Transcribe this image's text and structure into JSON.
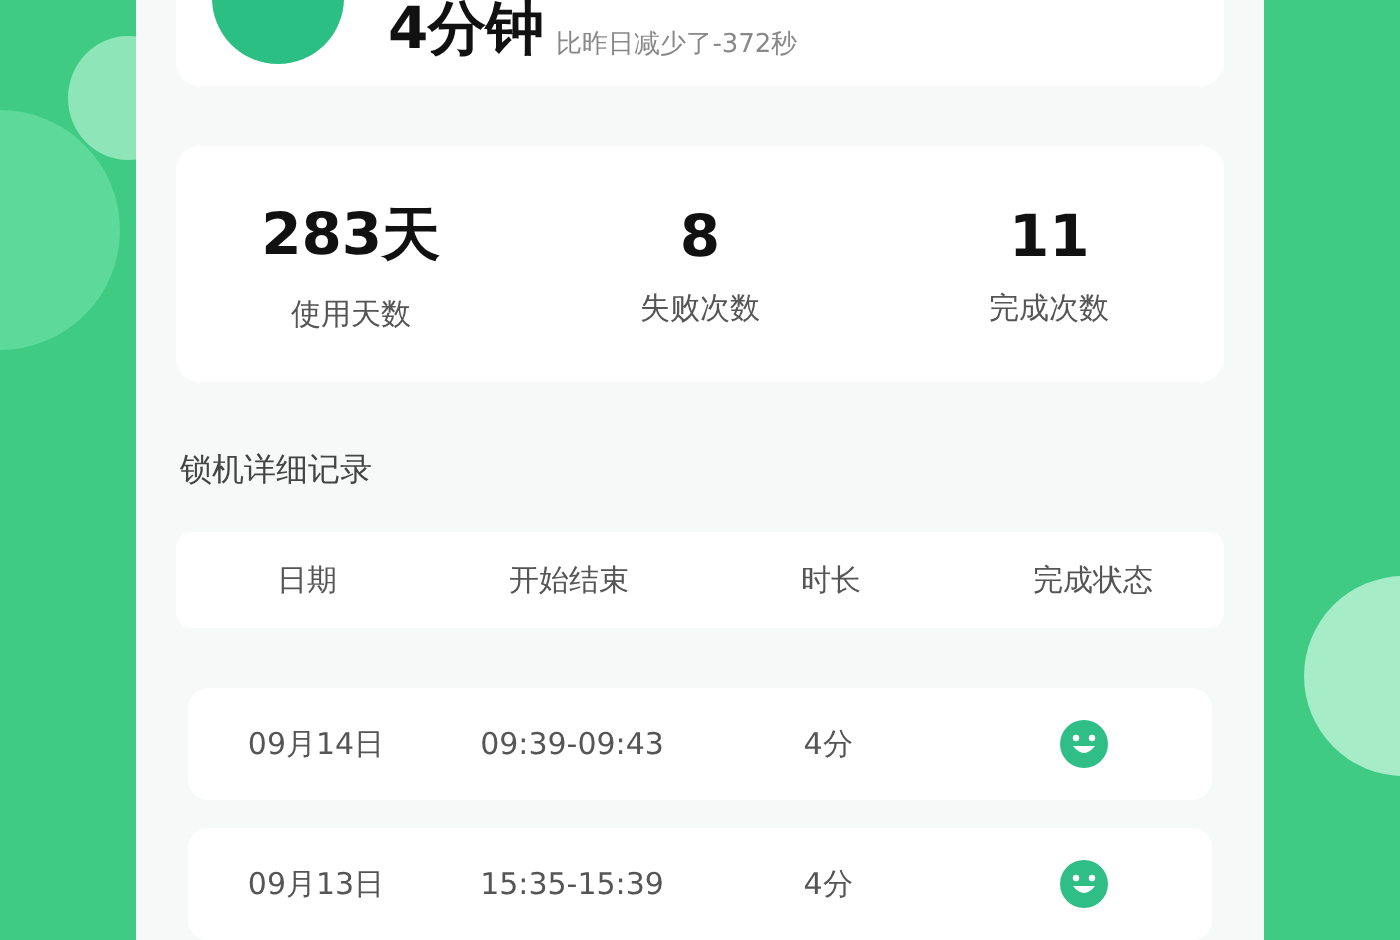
{
  "summary": {
    "duration": "4分钟",
    "comparison": "比昨日减少了-372秒"
  },
  "stats": [
    {
      "value": "283天",
      "label": "使用天数"
    },
    {
      "value": "8",
      "label": "失败次数"
    },
    {
      "value": "11",
      "label": "完成次数"
    }
  ],
  "records": {
    "title": "锁机详细记录",
    "columns": [
      "日期",
      "开始结束",
      "时长",
      "完成状态"
    ],
    "rows": [
      {
        "date": "09月14日",
        "time": "09:39-09:43",
        "length": "4分",
        "completed": true
      },
      {
        "date": "09月13日",
        "time": "15:35-15:39",
        "length": "4分",
        "completed": true
      }
    ]
  }
}
